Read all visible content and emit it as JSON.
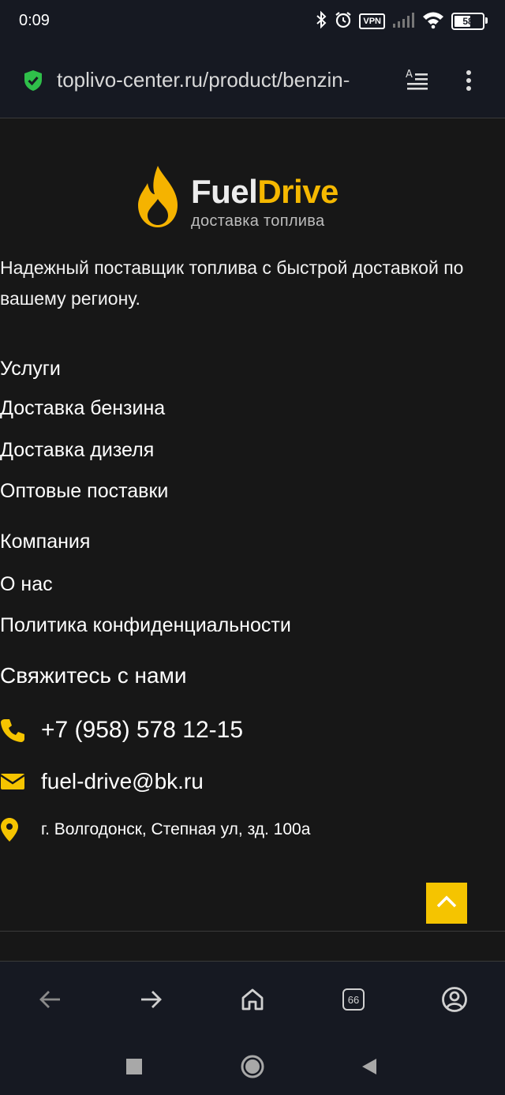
{
  "status_bar": {
    "time": "0:09",
    "vpn": "VPN",
    "battery": "58",
    "battery_level_percent": 58
  },
  "browser": {
    "url": "toplivo-center.ru/product/benzin-"
  },
  "logo": {
    "brand_part1": "Fuel",
    "brand_part2": "Drive",
    "tagline": "доставка топлива"
  },
  "footer": {
    "description": "Надежный поставщик топлива с быстрой доставкой по вашему региону.",
    "services": {
      "heading": "Услуги",
      "links": [
        "Доставка бензина",
        "Доставка дизеля",
        "Оптовые поставки"
      ]
    },
    "company": {
      "heading": "Компания",
      "links": [
        "О нас",
        "Политика конфиденциальности"
      ]
    },
    "contacts": {
      "heading": "Свяжитесь с нами",
      "phone": "+7 (958) 578 12-15",
      "email": "fuel-drive@bk.ru",
      "address": "г. Волгодонск, Степная ул, зд. 100а"
    }
  },
  "toolbar": {
    "tabs_count": "66"
  },
  "colors": {
    "accent": "#f5c400",
    "background": "#171717",
    "chrome": "#161922"
  }
}
